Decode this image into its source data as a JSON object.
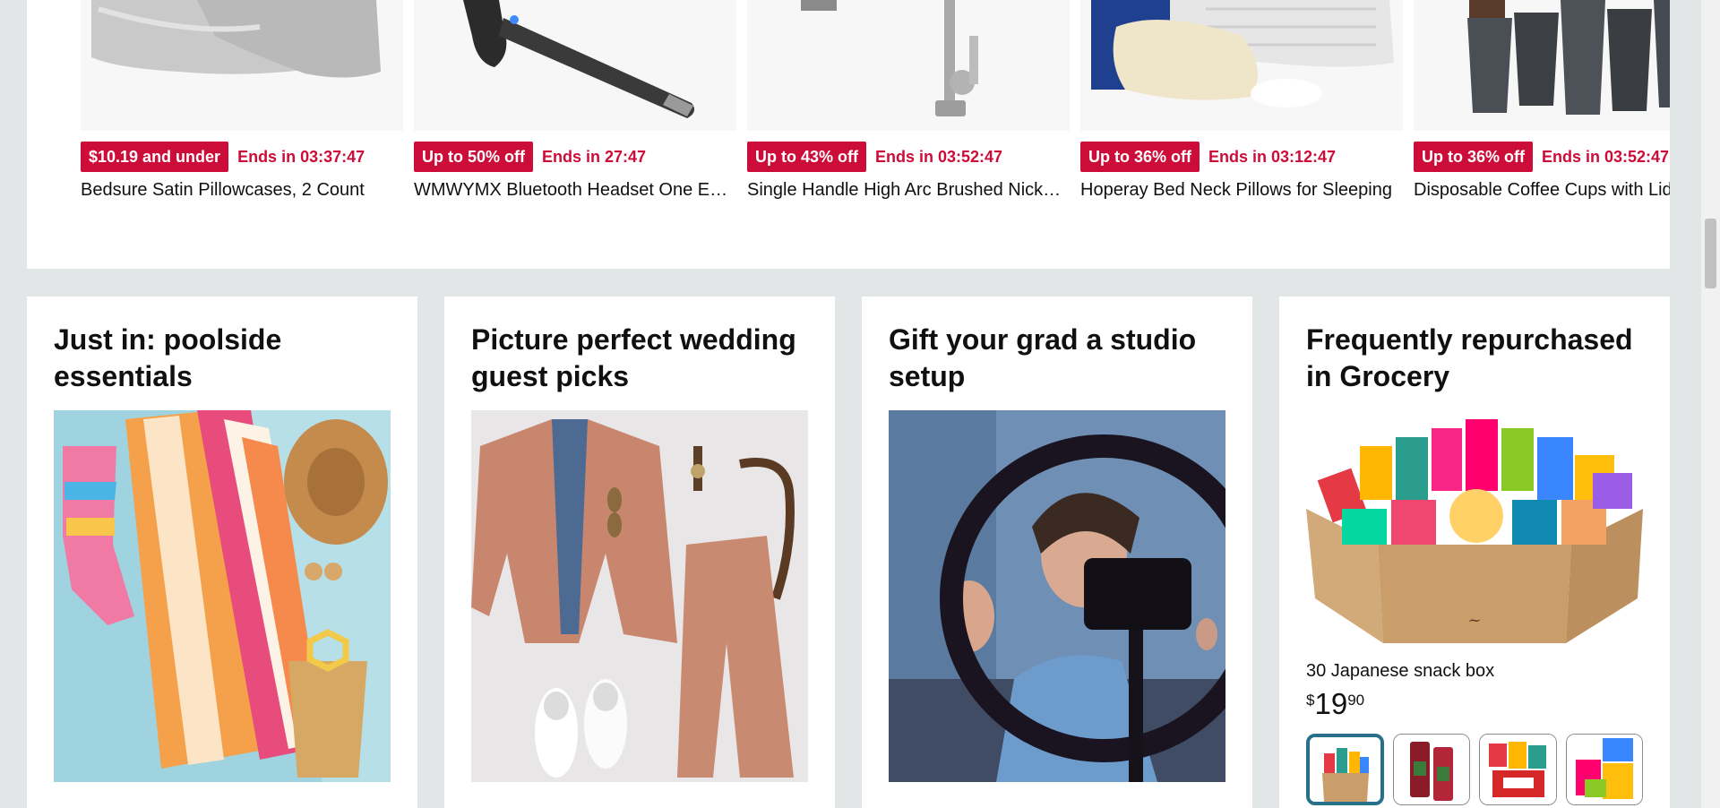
{
  "deals": [
    {
      "badge": "$10.19 and under",
      "ends": "Ends in 03:37:47",
      "title": "Bedsure Satin Pillowcases, 2 Count"
    },
    {
      "badge": "Up to 50% off",
      "ends": "Ends in 27:47",
      "title": "WMWYMX Bluetooth Headset One Ear Wireless"
    },
    {
      "badge": "Up to 43% off",
      "ends": "Ends in 03:52:47",
      "title": "Single Handle High Arc Brushed Nickel Kitchen Faucet"
    },
    {
      "badge": "Up to 36% off",
      "ends": "Ends in 03:12:47",
      "title": "Hoperay Bed Neck Pillows for Sleeping"
    },
    {
      "badge": "Up to 36% off",
      "ends": "Ends in 03:52:47",
      "title": "Disposable Coffee Cups with Lids"
    }
  ],
  "cards": {
    "poolside": {
      "title": "Just in: poolside essentials"
    },
    "wedding": {
      "title": "Picture perfect wedding guest picks"
    },
    "grad": {
      "title": "Gift your grad a studio setup"
    },
    "grocery": {
      "title": "Frequently repurchased in Grocery",
      "product_title": "30 Japanese snack box",
      "price_symbol": "$",
      "price_whole": "19",
      "price_fraction": "90"
    }
  },
  "colors": {
    "deal_red": "#cc0c39",
    "page_bg": "#e3e6e6",
    "thumb_active": "#2a6f8a"
  }
}
